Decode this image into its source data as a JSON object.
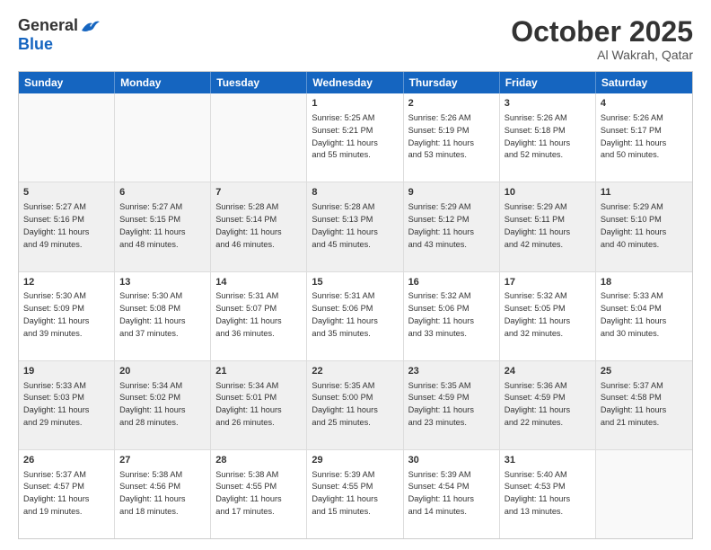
{
  "logo": {
    "general": "General",
    "blue": "Blue"
  },
  "title": "October 2025",
  "subtitle": "Al Wakrah, Qatar",
  "header_days": [
    "Sunday",
    "Monday",
    "Tuesday",
    "Wednesday",
    "Thursday",
    "Friday",
    "Saturday"
  ],
  "rows": [
    [
      {
        "day": "",
        "text": ""
      },
      {
        "day": "",
        "text": ""
      },
      {
        "day": "",
        "text": ""
      },
      {
        "day": "1",
        "text": "Sunrise: 5:25 AM\nSunset: 5:21 PM\nDaylight: 11 hours\nand 55 minutes."
      },
      {
        "day": "2",
        "text": "Sunrise: 5:26 AM\nSunset: 5:19 PM\nDaylight: 11 hours\nand 53 minutes."
      },
      {
        "day": "3",
        "text": "Sunrise: 5:26 AM\nSunset: 5:18 PM\nDaylight: 11 hours\nand 52 minutes."
      },
      {
        "day": "4",
        "text": "Sunrise: 5:26 AM\nSunset: 5:17 PM\nDaylight: 11 hours\nand 50 minutes."
      }
    ],
    [
      {
        "day": "5",
        "text": "Sunrise: 5:27 AM\nSunset: 5:16 PM\nDaylight: 11 hours\nand 49 minutes."
      },
      {
        "day": "6",
        "text": "Sunrise: 5:27 AM\nSunset: 5:15 PM\nDaylight: 11 hours\nand 48 minutes."
      },
      {
        "day": "7",
        "text": "Sunrise: 5:28 AM\nSunset: 5:14 PM\nDaylight: 11 hours\nand 46 minutes."
      },
      {
        "day": "8",
        "text": "Sunrise: 5:28 AM\nSunset: 5:13 PM\nDaylight: 11 hours\nand 45 minutes."
      },
      {
        "day": "9",
        "text": "Sunrise: 5:29 AM\nSunset: 5:12 PM\nDaylight: 11 hours\nand 43 minutes."
      },
      {
        "day": "10",
        "text": "Sunrise: 5:29 AM\nSunset: 5:11 PM\nDaylight: 11 hours\nand 42 minutes."
      },
      {
        "day": "11",
        "text": "Sunrise: 5:29 AM\nSunset: 5:10 PM\nDaylight: 11 hours\nand 40 minutes."
      }
    ],
    [
      {
        "day": "12",
        "text": "Sunrise: 5:30 AM\nSunset: 5:09 PM\nDaylight: 11 hours\nand 39 minutes."
      },
      {
        "day": "13",
        "text": "Sunrise: 5:30 AM\nSunset: 5:08 PM\nDaylight: 11 hours\nand 37 minutes."
      },
      {
        "day": "14",
        "text": "Sunrise: 5:31 AM\nSunset: 5:07 PM\nDaylight: 11 hours\nand 36 minutes."
      },
      {
        "day": "15",
        "text": "Sunrise: 5:31 AM\nSunset: 5:06 PM\nDaylight: 11 hours\nand 35 minutes."
      },
      {
        "day": "16",
        "text": "Sunrise: 5:32 AM\nSunset: 5:06 PM\nDaylight: 11 hours\nand 33 minutes."
      },
      {
        "day": "17",
        "text": "Sunrise: 5:32 AM\nSunset: 5:05 PM\nDaylight: 11 hours\nand 32 minutes."
      },
      {
        "day": "18",
        "text": "Sunrise: 5:33 AM\nSunset: 5:04 PM\nDaylight: 11 hours\nand 30 minutes."
      }
    ],
    [
      {
        "day": "19",
        "text": "Sunrise: 5:33 AM\nSunset: 5:03 PM\nDaylight: 11 hours\nand 29 minutes."
      },
      {
        "day": "20",
        "text": "Sunrise: 5:34 AM\nSunset: 5:02 PM\nDaylight: 11 hours\nand 28 minutes."
      },
      {
        "day": "21",
        "text": "Sunrise: 5:34 AM\nSunset: 5:01 PM\nDaylight: 11 hours\nand 26 minutes."
      },
      {
        "day": "22",
        "text": "Sunrise: 5:35 AM\nSunset: 5:00 PM\nDaylight: 11 hours\nand 25 minutes."
      },
      {
        "day": "23",
        "text": "Sunrise: 5:35 AM\nSunset: 4:59 PM\nDaylight: 11 hours\nand 23 minutes."
      },
      {
        "day": "24",
        "text": "Sunrise: 5:36 AM\nSunset: 4:59 PM\nDaylight: 11 hours\nand 22 minutes."
      },
      {
        "day": "25",
        "text": "Sunrise: 5:37 AM\nSunset: 4:58 PM\nDaylight: 11 hours\nand 21 minutes."
      }
    ],
    [
      {
        "day": "26",
        "text": "Sunrise: 5:37 AM\nSunset: 4:57 PM\nDaylight: 11 hours\nand 19 minutes."
      },
      {
        "day": "27",
        "text": "Sunrise: 5:38 AM\nSunset: 4:56 PM\nDaylight: 11 hours\nand 18 minutes."
      },
      {
        "day": "28",
        "text": "Sunrise: 5:38 AM\nSunset: 4:55 PM\nDaylight: 11 hours\nand 17 minutes."
      },
      {
        "day": "29",
        "text": "Sunrise: 5:39 AM\nSunset: 4:55 PM\nDaylight: 11 hours\nand 15 minutes."
      },
      {
        "day": "30",
        "text": "Sunrise: 5:39 AM\nSunset: 4:54 PM\nDaylight: 11 hours\nand 14 minutes."
      },
      {
        "day": "31",
        "text": "Sunrise: 5:40 AM\nSunset: 4:53 PM\nDaylight: 11 hours\nand 13 minutes."
      },
      {
        "day": "",
        "text": ""
      }
    ]
  ]
}
